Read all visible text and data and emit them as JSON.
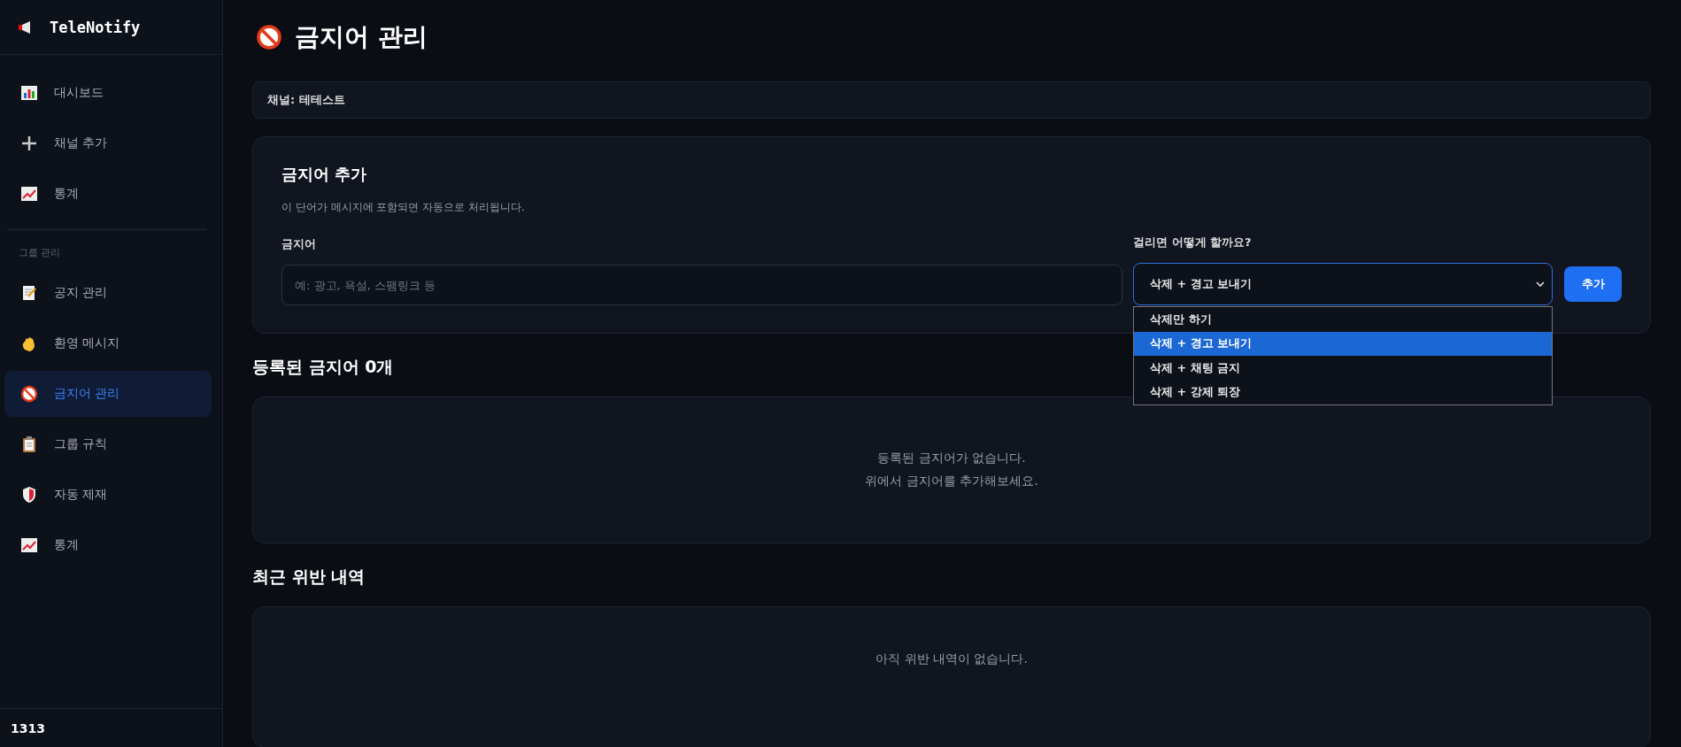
{
  "sidebar": {
    "brand": "TeleNotify",
    "main_items": [
      {
        "label": "대시보드",
        "kind": "chart",
        "selected": false
      },
      {
        "label": "채널 추가",
        "kind": "plus",
        "selected": false
      },
      {
        "label": "통계",
        "kind": "trend",
        "selected": false
      }
    ],
    "section_label": "그룹 관리",
    "group_items": [
      {
        "label": "공지 관리",
        "kind": "memo",
        "selected": false
      },
      {
        "label": "환영 메시지",
        "kind": "wave",
        "selected": false
      },
      {
        "label": "금지어 관리",
        "kind": "ban",
        "selected": true
      },
      {
        "label": "그룹 규칙",
        "kind": "clipboard",
        "selected": false
      },
      {
        "label": "자동 제재",
        "kind": "shield",
        "selected": false
      },
      {
        "label": "통계",
        "kind": "trend",
        "selected": false
      }
    ],
    "footer": "1313"
  },
  "page_title": "금지어 관리",
  "channel": "채널: 테테스트",
  "add_card": {
    "title": "금지어 추가",
    "description": "이 단어가 메시지에 포함되면 자동으로 처리됩니다.",
    "word_label": "금지어",
    "word_placeholder": "예: 광고, 욕설, 스팸링크 등",
    "action_label": "걸리면 어떻게 할까요?",
    "action_value": "삭제 + 경고 보내기",
    "options": [
      {
        "label": "삭제만 하기",
        "selected": false
      },
      {
        "label": "삭제 + 경고 보내기",
        "selected": true
      },
      {
        "label": "삭제 + 채팅 금지",
        "selected": false
      },
      {
        "label": "삭제 + 강제 퇴장",
        "selected": false
      }
    ],
    "button": "추가"
  },
  "words_section": {
    "title": "등록된 금지어 0개",
    "empty_lines": [
      "등록된 금지어가 없습니다.",
      "위에서 금지어를 추가해보세요."
    ]
  },
  "violations_section": {
    "title": "최근 위반 내역",
    "empty_lines": [
      "아직 위반 내역이 없습니다."
    ]
  }
}
